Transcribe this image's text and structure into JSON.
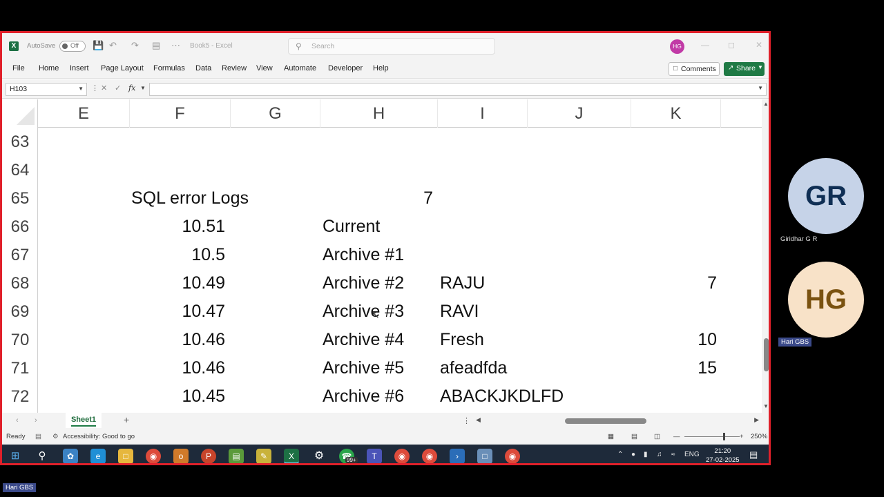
{
  "titlebar": {
    "autosave_label": "AutoSave",
    "autosave_state": "Off",
    "doc_title": "Book5 - Excel",
    "search_placeholder": "Search",
    "user_initials": "HG"
  },
  "menu": {
    "items": [
      "File",
      "Home",
      "Insert",
      "Page Layout",
      "Formulas",
      "Data",
      "Review",
      "View",
      "Automate",
      "Developer",
      "Help"
    ],
    "comments_label": "Comments",
    "share_label": "Share"
  },
  "formula_bar": {
    "name_box": "H103",
    "fx_label": "fx",
    "formula": ""
  },
  "sheet": {
    "columns": [
      "E",
      "F",
      "G",
      "H",
      "I",
      "J",
      "K"
    ],
    "rows": [
      "63",
      "64",
      "65",
      "66",
      "67",
      "68",
      "69",
      "70",
      "71",
      "72"
    ],
    "cells": {
      "r65_f": "SQL error Logs",
      "r65_h": "7",
      "r66_f": "10.51",
      "r66_h": "Current",
      "r67_f": "10.5",
      "r67_h": "Archive #1",
      "r68_f": "10.49",
      "r68_h": "Archive #2",
      "r68_i": "RAJU",
      "r68_k": "7",
      "r69_f": "10.47",
      "r69_h": "Archive #3",
      "r69_i": "RAVI",
      "r70_f": "10.46",
      "r70_h": "Archive #4",
      "r70_i": "Fresh",
      "r70_k": "10",
      "r71_f": "10.46",
      "r71_h": "Archive #5",
      "r71_i": "afeadfda",
      "r71_k": "15",
      "r72_f": "10.45",
      "r72_h": "Archive #6",
      "r72_i": "ABACKJKDLFD"
    },
    "tab_name": "Sheet1"
  },
  "status": {
    "ready": "Ready",
    "accessibility": "Accessibility: Good to go",
    "zoom": "250%"
  },
  "taskbar": {
    "lang": "ENG",
    "time": "21:20",
    "date": "27-02-2025",
    "badge": "99+"
  },
  "participants": {
    "p1_initials": "GR",
    "p1_name": "Giridhar G R",
    "p2_initials": "HG",
    "p2_name": "Hari GBS",
    "self_name": "Hari GBS"
  },
  "colors": {
    "share_border": "#e0202a",
    "excel_green": "#1f7a45",
    "avatar_gr_bg": "#c6d3e8",
    "avatar_hg_bg": "#f8e2c8"
  }
}
